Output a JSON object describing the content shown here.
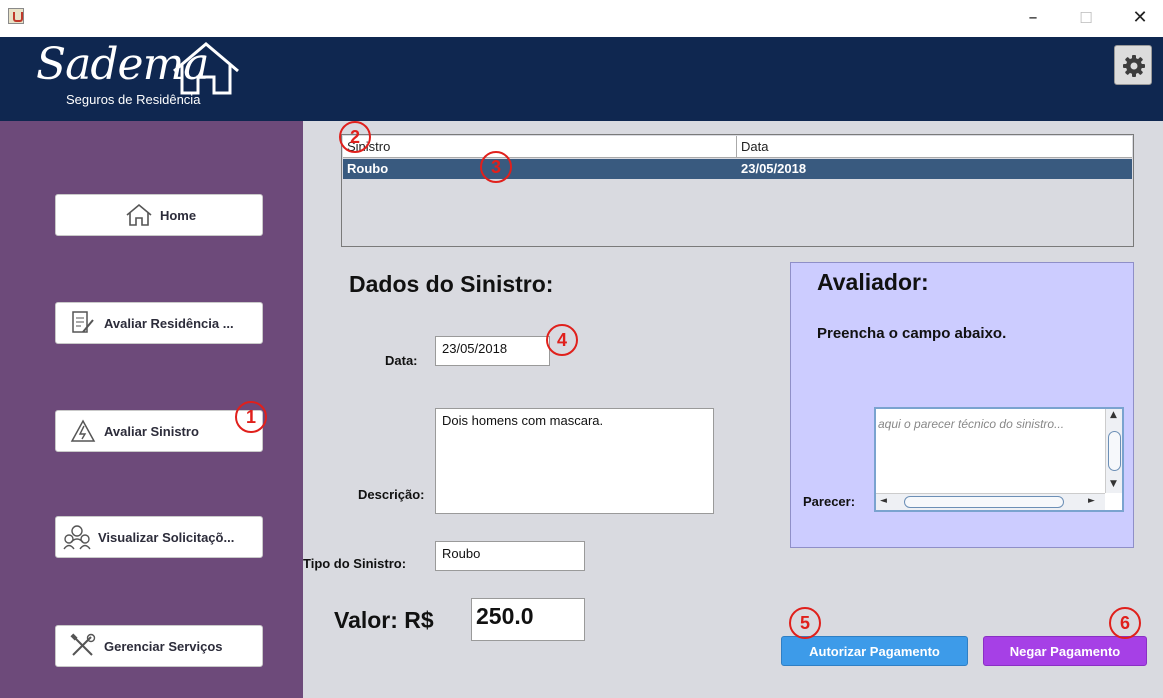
{
  "window": {
    "minimize_glyph": "–",
    "maximize_glyph": "☐",
    "close_glyph": "✕"
  },
  "header": {
    "logo_text": "Sadema",
    "logo_subtitle": "Seguros de Residência",
    "settings_icon": "gear-icon"
  },
  "sidebar": {
    "items": [
      {
        "label": "Home",
        "icon": "home-icon"
      },
      {
        "label": "Avaliar Residência ...",
        "icon": "edit-document-icon"
      },
      {
        "label": "Avaliar Sinistro",
        "icon": "warning-icon"
      },
      {
        "label": "Visualizar Solicitaçõ...",
        "icon": "users-icon"
      },
      {
        "label": "Gerenciar Serviços",
        "icon": "tools-icon"
      }
    ]
  },
  "table": {
    "columns": [
      "Sinistro",
      "Data"
    ],
    "rows": [
      {
        "sinistro": "Roubo",
        "data": "23/05/2018",
        "selected": true
      }
    ]
  },
  "dados": {
    "title": "Dados do Sinistro:",
    "data_label": "Data:",
    "data_value": "23/05/2018",
    "descricao_label": "Descrição:",
    "descricao_value": "Dois homens com mascara.",
    "tipo_label": "Tipo do Sinistro:",
    "tipo_value": "Roubo",
    "valor_label": "Valor: R$",
    "valor_value": "250.0"
  },
  "avaliador": {
    "title": "Avaliador:",
    "instruction": "Preencha o campo abaixo.",
    "parecer_label": "Parecer:",
    "parecer_placeholder": "aqui o parecer técnico do sinistro..."
  },
  "actions": {
    "autorizar_label": "Autorizar Pagamento",
    "negar_label": "Negar Pagamento"
  },
  "markers": [
    "1",
    "2",
    "3",
    "4",
    "5",
    "6"
  ],
  "colors": {
    "header_bg": "#0f2750",
    "sidebar_bg": "#6d4a7a",
    "content_bg": "#d9dae0",
    "selected_row": "#395a7f",
    "avaliador_bg": "#ccccff",
    "autorizar_btn": "#3d9be9",
    "negar_btn": "#a640e6",
    "marker": "#e0201c"
  }
}
